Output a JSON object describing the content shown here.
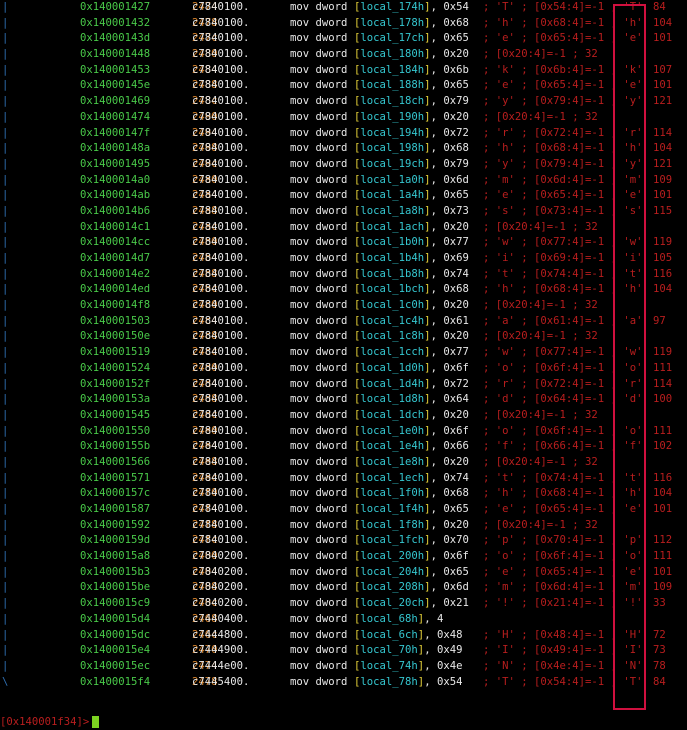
{
  "rows": [
    {
      "gutter": "|",
      "addr": "0x140001427",
      "bytes_a": "c784",
      "bytes_b": "2474",
      "bytes_c": "0100.",
      "mnem": "mov dword",
      "var": "local_174h",
      "imm": ", 0x54",
      "cmt": "; 'T' ; [0x54:4]=-1 ; 'T'",
      "dec": "84"
    },
    {
      "gutter": "|",
      "addr": "0x140001432",
      "bytes_a": "c784",
      "bytes_b": "2478",
      "bytes_c": "0100.",
      "mnem": "mov dword",
      "var": "local_178h",
      "imm": ", 0x68",
      "cmt": "; 'h' ; [0x68:4]=-1 ; 'h'",
      "dec": "104"
    },
    {
      "gutter": "|",
      "addr": "0x14000143d",
      "bytes_a": "c784",
      "bytes_b": "247c",
      "bytes_c": "0100.",
      "mnem": "mov dword",
      "var": "local_17ch",
      "imm": ", 0x65",
      "cmt": "; 'e' ; [0x65:4]=-1 ; 'e'",
      "dec": "101"
    },
    {
      "gutter": "|",
      "addr": "0x140001448",
      "bytes_a": "c784",
      "bytes_b": "2480",
      "bytes_c": "0100.",
      "mnem": "mov dword",
      "var": "local_180h",
      "imm": ", 0x20",
      "cmt": "; [0x20:4]=-1 ; 32",
      "dec": ""
    },
    {
      "gutter": "|",
      "addr": "0x140001453",
      "bytes_a": "c784",
      "bytes_b": "2484",
      "bytes_c": "0100.",
      "mnem": "mov dword",
      "var": "local_184h",
      "imm": ", 0x6b",
      "cmt": "; 'k' ; [0x6b:4]=-1 ; 'k'",
      "dec": "107"
    },
    {
      "gutter": "|",
      "addr": "0x14000145e",
      "bytes_a": "c784",
      "bytes_b": "2488",
      "bytes_c": "0100.",
      "mnem": "mov dword",
      "var": "local_188h",
      "imm": ", 0x65",
      "cmt": "; 'e' ; [0x65:4]=-1 ; 'e'",
      "dec": "101"
    },
    {
      "gutter": "|",
      "addr": "0x140001469",
      "bytes_a": "c784",
      "bytes_b": "248c",
      "bytes_c": "0100.",
      "mnem": "mov dword",
      "var": "local_18ch",
      "imm": ", 0x79",
      "cmt": "; 'y' ; [0x79:4]=-1 ; 'y'",
      "dec": "121"
    },
    {
      "gutter": "|",
      "addr": "0x140001474",
      "bytes_a": "c784",
      "bytes_b": "2490",
      "bytes_c": "0100.",
      "mnem": "mov dword",
      "var": "local_190h",
      "imm": ", 0x20",
      "cmt": "; [0x20:4]=-1 ; 32",
      "dec": ""
    },
    {
      "gutter": "|",
      "addr": "0x14000147f",
      "bytes_a": "c784",
      "bytes_b": "2494",
      "bytes_c": "0100.",
      "mnem": "mov dword",
      "var": "local_194h",
      "imm": ", 0x72",
      "cmt": "; 'r' ; [0x72:4]=-1 ; 'r'",
      "dec": "114"
    },
    {
      "gutter": "|",
      "addr": "0x14000148a",
      "bytes_a": "c784",
      "bytes_b": "2498",
      "bytes_c": "0100.",
      "mnem": "mov dword",
      "var": "local_198h",
      "imm": ", 0x68",
      "cmt": "; 'h' ; [0x68:4]=-1 ; 'h'",
      "dec": "104"
    },
    {
      "gutter": "|",
      "addr": "0x140001495",
      "bytes_a": "c784",
      "bytes_b": "249c",
      "bytes_c": "0100.",
      "mnem": "mov dword",
      "var": "local_19ch",
      "imm": ", 0x79",
      "cmt": "; 'y' ; [0x79:4]=-1 ; 'y'",
      "dec": "121"
    },
    {
      "gutter": "|",
      "addr": "0x1400014a0",
      "bytes_a": "c784",
      "bytes_b": "24a0",
      "bytes_c": "0100.",
      "mnem": "mov dword",
      "var": "local_1a0h",
      "imm": ", 0x6d",
      "cmt": "; 'm' ; [0x6d:4]=-1 ; 'm'",
      "dec": "109"
    },
    {
      "gutter": "|",
      "addr": "0x1400014ab",
      "bytes_a": "c784",
      "bytes_b": "24a4",
      "bytes_c": "0100.",
      "mnem": "mov dword",
      "var": "local_1a4h",
      "imm": ", 0x65",
      "cmt": "; 'e' ; [0x65:4]=-1 ; 'e'",
      "dec": "101"
    },
    {
      "gutter": "|",
      "addr": "0x1400014b6",
      "bytes_a": "c784",
      "bytes_b": "24a8",
      "bytes_c": "0100.",
      "mnem": "mov dword",
      "var": "local_1a8h",
      "imm": ", 0x73",
      "cmt": "; 's' ; [0x73:4]=-1 ; 's'",
      "dec": "115"
    },
    {
      "gutter": "|",
      "addr": "0x1400014c1",
      "bytes_a": "c784",
      "bytes_b": "24ac",
      "bytes_c": "0100.",
      "mnem": "mov dword",
      "var": "local_1ach",
      "imm": ", 0x20",
      "cmt": "; [0x20:4]=-1 ; 32",
      "dec": ""
    },
    {
      "gutter": "|",
      "addr": "0x1400014cc",
      "bytes_a": "c784",
      "bytes_b": "24b0",
      "bytes_c": "0100.",
      "mnem": "mov dword",
      "var": "local_1b0h",
      "imm": ", 0x77",
      "cmt": "; 'w' ; [0x77:4]=-1 ; 'w'",
      "dec": "119"
    },
    {
      "gutter": "|",
      "addr": "0x1400014d7",
      "bytes_a": "c784",
      "bytes_b": "24b4",
      "bytes_c": "0100.",
      "mnem": "mov dword",
      "var": "local_1b4h",
      "imm": ", 0x69",
      "cmt": "; 'i' ; [0x69:4]=-1 ; 'i'",
      "dec": "105"
    },
    {
      "gutter": "|",
      "addr": "0x1400014e2",
      "bytes_a": "c784",
      "bytes_b": "24b8",
      "bytes_c": "0100.",
      "mnem": "mov dword",
      "var": "local_1b8h",
      "imm": ", 0x74",
      "cmt": "; 't' ; [0x74:4]=-1 ; 't'",
      "dec": "116"
    },
    {
      "gutter": "|",
      "addr": "0x1400014ed",
      "bytes_a": "c784",
      "bytes_b": "24bc",
      "bytes_c": "0100.",
      "mnem": "mov dword",
      "var": "local_1bch",
      "imm": ", 0x68",
      "cmt": "; 'h' ; [0x68:4]=-1 ; 'h'",
      "dec": "104"
    },
    {
      "gutter": "|",
      "addr": "0x1400014f8",
      "bytes_a": "c784",
      "bytes_b": "24c0",
      "bytes_c": "0100.",
      "mnem": "mov dword",
      "var": "local_1c0h",
      "imm": ", 0x20",
      "cmt": "; [0x20:4]=-1 ; 32",
      "dec": ""
    },
    {
      "gutter": "|",
      "addr": "0x140001503",
      "bytes_a": "c784",
      "bytes_b": "24c4",
      "bytes_c": "0100.",
      "mnem": "mov dword",
      "var": "local_1c4h",
      "imm": ", 0x61",
      "cmt": "; 'a' ; [0x61:4]=-1 ; 'a'",
      "dec": "97"
    },
    {
      "gutter": "|",
      "addr": "0x14000150e",
      "bytes_a": "c784",
      "bytes_b": "24c8",
      "bytes_c": "0100.",
      "mnem": "mov dword",
      "var": "local_1c8h",
      "imm": ", 0x20",
      "cmt": "; [0x20:4]=-1 ; 32",
      "dec": ""
    },
    {
      "gutter": "|",
      "addr": "0x140001519",
      "bytes_a": "c784",
      "bytes_b": "24cc",
      "bytes_c": "0100.",
      "mnem": "mov dword",
      "var": "local_1cch",
      "imm": ", 0x77",
      "cmt": "; 'w' ; [0x77:4]=-1 ; 'w'",
      "dec": "119"
    },
    {
      "gutter": "|",
      "addr": "0x140001524",
      "bytes_a": "c784",
      "bytes_b": "24d0",
      "bytes_c": "0100.",
      "mnem": "mov dword",
      "var": "local_1d0h",
      "imm": ", 0x6f",
      "cmt": "; 'o' ; [0x6f:4]=-1 ; 'o'",
      "dec": "111"
    },
    {
      "gutter": "|",
      "addr": "0x14000152f",
      "bytes_a": "c784",
      "bytes_b": "24d4",
      "bytes_c": "0100.",
      "mnem": "mov dword",
      "var": "local_1d4h",
      "imm": ", 0x72",
      "cmt": "; 'r' ; [0x72:4]=-1 ; 'r'",
      "dec": "114"
    },
    {
      "gutter": "|",
      "addr": "0x14000153a",
      "bytes_a": "c784",
      "bytes_b": "24d8",
      "bytes_c": "0100.",
      "mnem": "mov dword",
      "var": "local_1d8h",
      "imm": ", 0x64",
      "cmt": "; 'd' ; [0x64:4]=-1 ; 'd'",
      "dec": "100"
    },
    {
      "gutter": "|",
      "addr": "0x140001545",
      "bytes_a": "c784",
      "bytes_b": "24dc",
      "bytes_c": "0100.",
      "mnem": "mov dword",
      "var": "local_1dch",
      "imm": ", 0x20",
      "cmt": "; [0x20:4]=-1 ; 32",
      "dec": ""
    },
    {
      "gutter": "|",
      "addr": "0x140001550",
      "bytes_a": "c784",
      "bytes_b": "24e0",
      "bytes_c": "0100.",
      "mnem": "mov dword",
      "var": "local_1e0h",
      "imm": ", 0x6f",
      "cmt": "; 'o' ; [0x6f:4]=-1 ; 'o'",
      "dec": "111"
    },
    {
      "gutter": "|",
      "addr": "0x14000155b",
      "bytes_a": "c784",
      "bytes_b": "24e4",
      "bytes_c": "0100.",
      "mnem": "mov dword",
      "var": "local_1e4h",
      "imm": ", 0x66",
      "cmt": "; 'f' ; [0x66:4]=-1 ; 'f'",
      "dec": "102"
    },
    {
      "gutter": "|",
      "addr": "0x140001566",
      "bytes_a": "c784",
      "bytes_b": "24e8",
      "bytes_c": "0100.",
      "mnem": "mov dword",
      "var": "local_1e8h",
      "imm": ", 0x20",
      "cmt": "; [0x20:4]=-1 ; 32",
      "dec": ""
    },
    {
      "gutter": "|",
      "addr": "0x140001571",
      "bytes_a": "c784",
      "bytes_b": "24ec",
      "bytes_c": "0100.",
      "mnem": "mov dword",
      "var": "local_1ech",
      "imm": ", 0x74",
      "cmt": "; 't' ; [0x74:4]=-1 ; 't'",
      "dec": "116"
    },
    {
      "gutter": "|",
      "addr": "0x14000157c",
      "bytes_a": "c784",
      "bytes_b": "24f0",
      "bytes_c": "0100.",
      "mnem": "mov dword",
      "var": "local_1f0h",
      "imm": ", 0x68",
      "cmt": "; 'h' ; [0x68:4]=-1 ; 'h'",
      "dec": "104"
    },
    {
      "gutter": "|",
      "addr": "0x140001587",
      "bytes_a": "c784",
      "bytes_b": "24f4",
      "bytes_c": "0100.",
      "mnem": "mov dword",
      "var": "local_1f4h",
      "imm": ", 0x65",
      "cmt": "; 'e' ; [0x65:4]=-1 ; 'e'",
      "dec": "101"
    },
    {
      "gutter": "|",
      "addr": "0x140001592",
      "bytes_a": "c784",
      "bytes_b": "24f8",
      "bytes_c": "0100.",
      "mnem": "mov dword",
      "var": "local_1f8h",
      "imm": ", 0x20",
      "cmt": "; [0x20:4]=-1 ; 32",
      "dec": ""
    },
    {
      "gutter": "|",
      "addr": "0x14000159d",
      "bytes_a": "c784",
      "bytes_b": "24fc",
      "bytes_c": "0100.",
      "mnem": "mov dword",
      "var": "local_1fch",
      "imm": ", 0x70",
      "cmt": "; 'p' ; [0x70:4]=-1 ; 'p'",
      "dec": "112"
    },
    {
      "gutter": "|",
      "addr": "0x1400015a8",
      "bytes_a": "c784",
      "bytes_b": "2400",
      "bytes_c": "0200.",
      "mnem": "mov dword",
      "var": "local_200h",
      "imm": ", 0x6f",
      "cmt": "; 'o' ; [0x6f:4]=-1 ; 'o'",
      "dec": "111"
    },
    {
      "gutter": "|",
      "addr": "0x1400015b3",
      "bytes_a": "c784",
      "bytes_b": "2404",
      "bytes_c": "0200.",
      "mnem": "mov dword",
      "var": "local_204h",
      "imm": ", 0x65",
      "cmt": "; 'e' ; [0x65:4]=-1 ; 'e'",
      "dec": "101"
    },
    {
      "gutter": "|",
      "addr": "0x1400015be",
      "bytes_a": "c784",
      "bytes_b": "2408",
      "bytes_c": "0200.",
      "mnem": "mov dword",
      "var": "local_208h",
      "imm": ", 0x6d",
      "cmt": "; 'm' ; [0x6d:4]=-1 ; 'm'",
      "dec": "109"
    },
    {
      "gutter": "|",
      "addr": "0x1400015c9",
      "bytes_a": "c784",
      "bytes_b": "240c",
      "bytes_c": "0200.",
      "mnem": "mov dword",
      "var": "local_20ch",
      "imm": ", 0x21",
      "cmt": "; '!' ; [0x21:4]=-1 ; '!'",
      "dec": "33"
    },
    {
      "gutter": "|",
      "addr": "0x1400015d4",
      "bytes_a": "c744",
      "bytes_b": "2468",
      "bytes_c": "0400.",
      "mnem": "mov dword",
      "var": "local_68h",
      "imm": ", 4",
      "cmt": "",
      "dec": ""
    },
    {
      "gutter": "|",
      "addr": "0x1400015dc",
      "bytes_a": "c744",
      "bytes_b": "246c",
      "bytes_c": "4800.",
      "mnem": "mov dword",
      "var": "local_6ch",
      "imm": ", 0x48",
      "cmt": "; 'H' ; [0x48:4]=-1 ; 'H'",
      "dec": "72"
    },
    {
      "gutter": "|",
      "addr": "0x1400015e4",
      "bytes_a": "c744",
      "bytes_b": "2470",
      "bytes_c": "4900.",
      "mnem": "mov dword",
      "var": "local_70h",
      "imm": ", 0x49",
      "cmt": "; 'I' ; [0x49:4]=-1 ; 'I'",
      "dec": "73"
    },
    {
      "gutter": "|",
      "addr": "0x1400015ec",
      "bytes_a": "c744",
      "bytes_b": "2474",
      "bytes_c": "4e00.",
      "mnem": "mov dword",
      "var": "local_74h",
      "imm": ", 0x4e",
      "cmt": "; 'N' ; [0x4e:4]=-1 ; 'N'",
      "dec": "78"
    },
    {
      "gutter": "\\",
      "addr": "0x1400015f4",
      "bytes_a": "c744",
      "bytes_b": "2478",
      "bytes_c": "5400.",
      "mnem": "mov dword",
      "var": "local_78h",
      "imm": ", 0x54",
      "cmt": "; 'T' ; [0x54:4]=-1 ; 'T'",
      "dec": "84"
    }
  ],
  "prompt": {
    "text": "[0x140001f34]>"
  },
  "colors": {
    "background": "#000000",
    "address": "#49c949",
    "comment": "#b81e1e",
    "variable": "#35c6cf",
    "bracket": "#e6d23a",
    "highlight_box": "#d0103f",
    "cursor": "#7dd321"
  }
}
